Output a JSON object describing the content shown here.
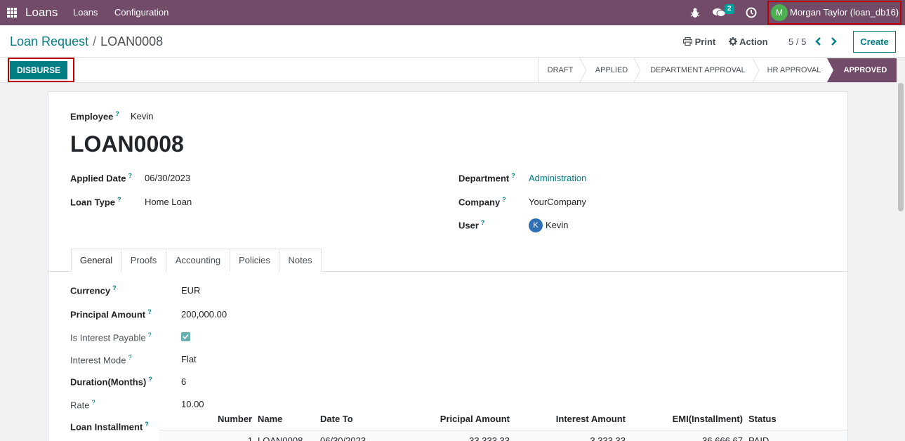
{
  "navbar": {
    "app_name": "Loans",
    "menu": [
      "Loans",
      "Configuration"
    ],
    "chat_count": "2",
    "user_initial": "M",
    "user_name": "Morgan Taylor (loan_db16)"
  },
  "control": {
    "breadcrumb_parent": "Loan Request",
    "breadcrumb_sep": "/",
    "breadcrumb_current": "LOAN0008",
    "print_label": "Print",
    "action_label": "Action",
    "pager": "5 / 5",
    "create_label": "Create"
  },
  "statusbar": {
    "disburse_label": "DISBURSE",
    "stages": [
      "DRAFT",
      "APPLIED",
      "DEPARTMENT APPROVAL",
      "HR APPROVAL",
      "APPROVED"
    ],
    "active_stage": "APPROVED"
  },
  "form": {
    "employee_label": "Employee",
    "employee_value": "Kevin",
    "title": "LOAN0008",
    "applied_date_label": "Applied Date",
    "applied_date_value": "06/30/2023",
    "loan_type_label": "Loan Type",
    "loan_type_value": "Home Loan",
    "department_label": "Department",
    "department_value": "Administration",
    "company_label": "Company",
    "company_value": "YourCompany",
    "user_label": "User",
    "user_initial": "K",
    "user_value": "Kevin",
    "help_mark": "?"
  },
  "tabs": [
    "General",
    "Proofs",
    "Accounting",
    "Policies",
    "Notes"
  ],
  "general": {
    "currency_label": "Currency",
    "currency_value": "EUR",
    "principal_label": "Principal Amount",
    "principal_value": "200,000.00",
    "interest_payable_label": "Is Interest Payable",
    "interest_payable_checked": true,
    "interest_mode_label": "Interest Mode",
    "interest_mode_value": "Flat",
    "duration_label": "Duration(Months)",
    "duration_value": "6",
    "rate_label": "Rate",
    "rate_value": "10.00",
    "installment_label": "Loan Installment"
  },
  "installments": {
    "columns": [
      "Number",
      "Name",
      "Date To",
      "Pricipal Amount",
      "Interest Amount",
      "EMI(Installment)",
      "Status"
    ],
    "rows": [
      [
        "1",
        "LOAN0008",
        "06/30/2023",
        "33,333.33",
        "3,333.33",
        "36,666.67",
        "PAID"
      ]
    ]
  },
  "colors": {
    "navbar": "#714b67",
    "accent": "#017e84",
    "highlight_border": "#c00000"
  }
}
